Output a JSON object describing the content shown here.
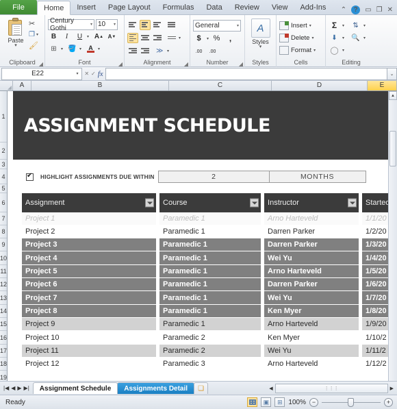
{
  "window": {
    "ribbon_tabs": [
      "File",
      "Home",
      "Insert",
      "Page Layout",
      "Formulas",
      "Data",
      "Review",
      "View",
      "Add-Ins"
    ],
    "active_ribbon_tab": "Home",
    "minimize_glyph": "▭",
    "restore_glyph": "❐",
    "close_glyph": "✕",
    "collapse_glyph": "⌃",
    "help_glyph": "?"
  },
  "ribbon": {
    "clipboard": {
      "label": "Clipboard",
      "paste": "Paste",
      "cut_icon": "scissors-icon",
      "copy_icon": "copy-icon",
      "format_painter_icon": "format-painter-icon"
    },
    "font": {
      "label": "Font",
      "font_name": "Century Gothi",
      "font_size": "10",
      "bold": "B",
      "italic": "I",
      "underline": "U",
      "grow": "A",
      "shrink": "A",
      "borders_icon": "borders-icon",
      "fill_icon": "fill-color-icon",
      "font_color": "A"
    },
    "alignment": {
      "label": "Alignment"
    },
    "number": {
      "label": "Number",
      "format": "General",
      "currency": "$",
      "percent": "%",
      "comma": ",",
      "inc_dec": ".00",
      "dec_dec": ".00"
    },
    "styles": {
      "label": "Styles",
      "button": "Styles"
    },
    "cells": {
      "label": "Cells",
      "insert": "Insert",
      "delete": "Delete",
      "format": "Format"
    },
    "editing": {
      "label": "Editing",
      "autosum": "Σ",
      "sort_filter": "sort-filter-icon",
      "fill": "fill-down-icon",
      "find": "find-icon",
      "clear": "clear-icon"
    }
  },
  "formula_bar": {
    "name_box": "E22",
    "formula": "",
    "fx_label": "fx",
    "expand_glyph": "⌄"
  },
  "grid": {
    "columns": [
      "A",
      "B",
      "C",
      "D",
      "E"
    ],
    "selected_column": "E",
    "rows": [
      "1",
      "2",
      "3",
      "4",
      "5",
      "6",
      "7",
      "8",
      "9",
      "10",
      "11",
      "12",
      "13",
      "14",
      "15",
      "16",
      "17",
      "18",
      "19"
    ],
    "banner_title": "ASSIGNMENT SCHEDULE",
    "control": {
      "checkbox_checked": true,
      "label": "HIGHLIGHT ASSIGNMENTS DUE WITHIN",
      "value": "2",
      "unit": "MONTHS"
    },
    "table_headers": [
      "Assignment",
      "Course",
      "Instructor",
      "Started"
    ],
    "table_rows": [
      {
        "assignment": "Project 1",
        "course": "Paramedic 1",
        "instructor": "Arno Harteveld",
        "started": "1/1/20",
        "style": "past"
      },
      {
        "assignment": "Project 2",
        "course": "Paramedic 1",
        "instructor": "Darren Parker",
        "started": "1/2/20",
        "style": "plain"
      },
      {
        "assignment": "Project 3",
        "course": "Paramedic 1",
        "instructor": "Darren Parker",
        "started": "1/3/20",
        "style": "hl"
      },
      {
        "assignment": "Project 4",
        "course": "Paramedic 1",
        "instructor": "Wei Yu",
        "started": "1/4/20",
        "style": "hl"
      },
      {
        "assignment": "Project 5",
        "course": "Paramedic 1",
        "instructor": "Arno Harteveld",
        "started": "1/5/20",
        "style": "hl"
      },
      {
        "assignment": "Project 6",
        "course": "Paramedic 1",
        "instructor": "Darren Parker",
        "started": "1/6/20",
        "style": "hl"
      },
      {
        "assignment": "Project 7",
        "course": "Paramedic 1",
        "instructor": "Wei Yu",
        "started": "1/7/20",
        "style": "hl"
      },
      {
        "assignment": "Project 8",
        "course": "Paramedic 1",
        "instructor": "Ken Myer",
        "started": "1/8/20",
        "style": "hl"
      },
      {
        "assignment": "Project 9",
        "course": "Paramedic 1",
        "instructor": "Arno Harteveld",
        "started": "1/9/20",
        "style": "band"
      },
      {
        "assignment": "Project 10",
        "course": "Paramedic 2",
        "instructor": "Ken Myer",
        "started": "1/10/2",
        "style": "plain"
      },
      {
        "assignment": "Project 11",
        "course": "Paramedic 2",
        "instructor": "Wei Yu",
        "started": "1/11/2",
        "style": "band"
      },
      {
        "assignment": "Project 12",
        "course": "Paramedic 3",
        "instructor": "Arno Harteveld",
        "started": "1/12/2",
        "style": "plain"
      }
    ]
  },
  "sheet_tabs": {
    "nav_first": "◀◀",
    "nav_prev": "◀",
    "nav_next": "▶",
    "nav_last": "▶▶",
    "tabs": [
      {
        "label": "Assignment Schedule",
        "state": "active"
      },
      {
        "label": "Assignments Detail",
        "state": "sel2"
      }
    ],
    "new_sheet_icon": "new-sheet-icon"
  },
  "status_bar": {
    "status": "Ready",
    "view_normal_icon": "view-normal-icon",
    "view_layout_icon": "view-page-layout-icon",
    "view_break_icon": "view-page-break-icon",
    "zoom": "100%",
    "zoom_out": "−",
    "zoom_in": "+"
  }
}
